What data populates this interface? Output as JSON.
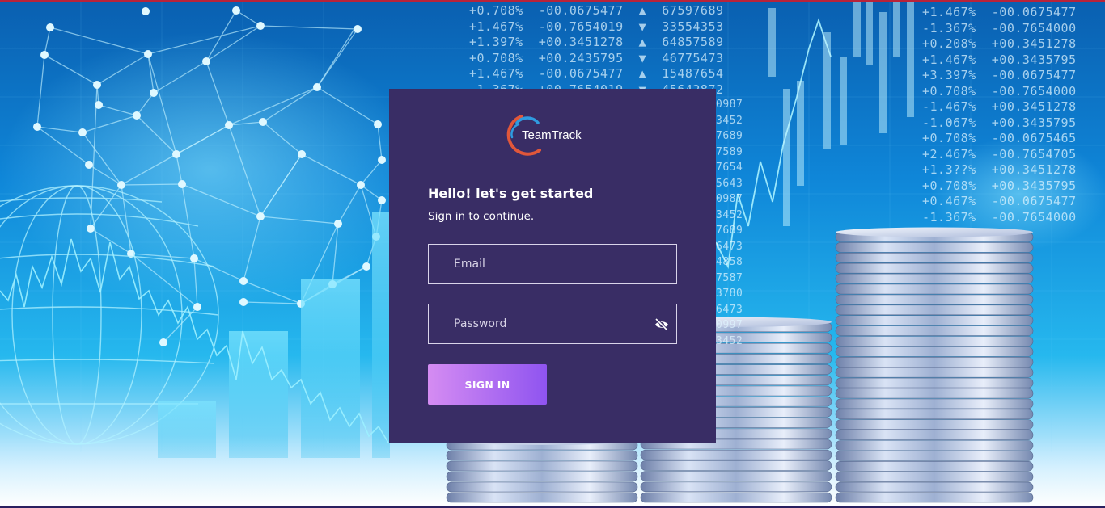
{
  "brand": {
    "name": "TeamTrack"
  },
  "login": {
    "heading": "Hello! let's get started",
    "subheading": "Sign in to continue.",
    "email_placeholder": "Email",
    "password_placeholder": "Password",
    "signin_label": "SIGN IN"
  },
  "background": {
    "ticker_left": {
      "pct": [
        "+0.708%",
        "+1.467%",
        "+1.397%",
        "+0.708%",
        "+1.467%",
        "-1.367%"
      ],
      "val": [
        "-00.0675477",
        "-00.7654019",
        "+00.3451278",
        "+00.2435795",
        "-00.0675477",
        "+00.7654019"
      ],
      "num": [
        "67597689",
        "33554353",
        "64857589",
        "46775473",
        "15487654",
        "45642872"
      ]
    },
    "ticker_right": {
      "pct": [
        "+1.467%",
        "-1.367%",
        "+0.208%",
        "+1.467%",
        "+3.397%",
        "+0.708%",
        "-1.467%",
        "-1.067%",
        "+0.708%",
        "+2.467%",
        "+1.3??%",
        "+0.708%",
        "+0.467%",
        "-1.367%"
      ],
      "val": [
        "-00.0675477",
        "-00.7654000",
        "+00.3451278",
        "+00.3435795",
        "-00.0675477",
        "-00.7654000",
        "+00.3451278",
        "+00.3435795",
        "-00.0675465",
        "-00.7654705",
        "+00.3451278",
        "+00.3435795",
        "-00.0675477",
        "-00.7654000"
      ]
    },
    "ticker_mid": [
      "0987",
      "3452",
      "7689",
      "7589",
      "7654",
      "5643",
      "0987",
      "3452",
      "7689",
      "6473",
      "4858",
      "7587",
      "3780",
      "6473",
      "0997",
      "3452"
    ],
    "colors": {
      "card": "#392d65",
      "button_start": "#d58cf2",
      "button_end": "#8f54f0",
      "top_bar": "#b8233a"
    }
  }
}
